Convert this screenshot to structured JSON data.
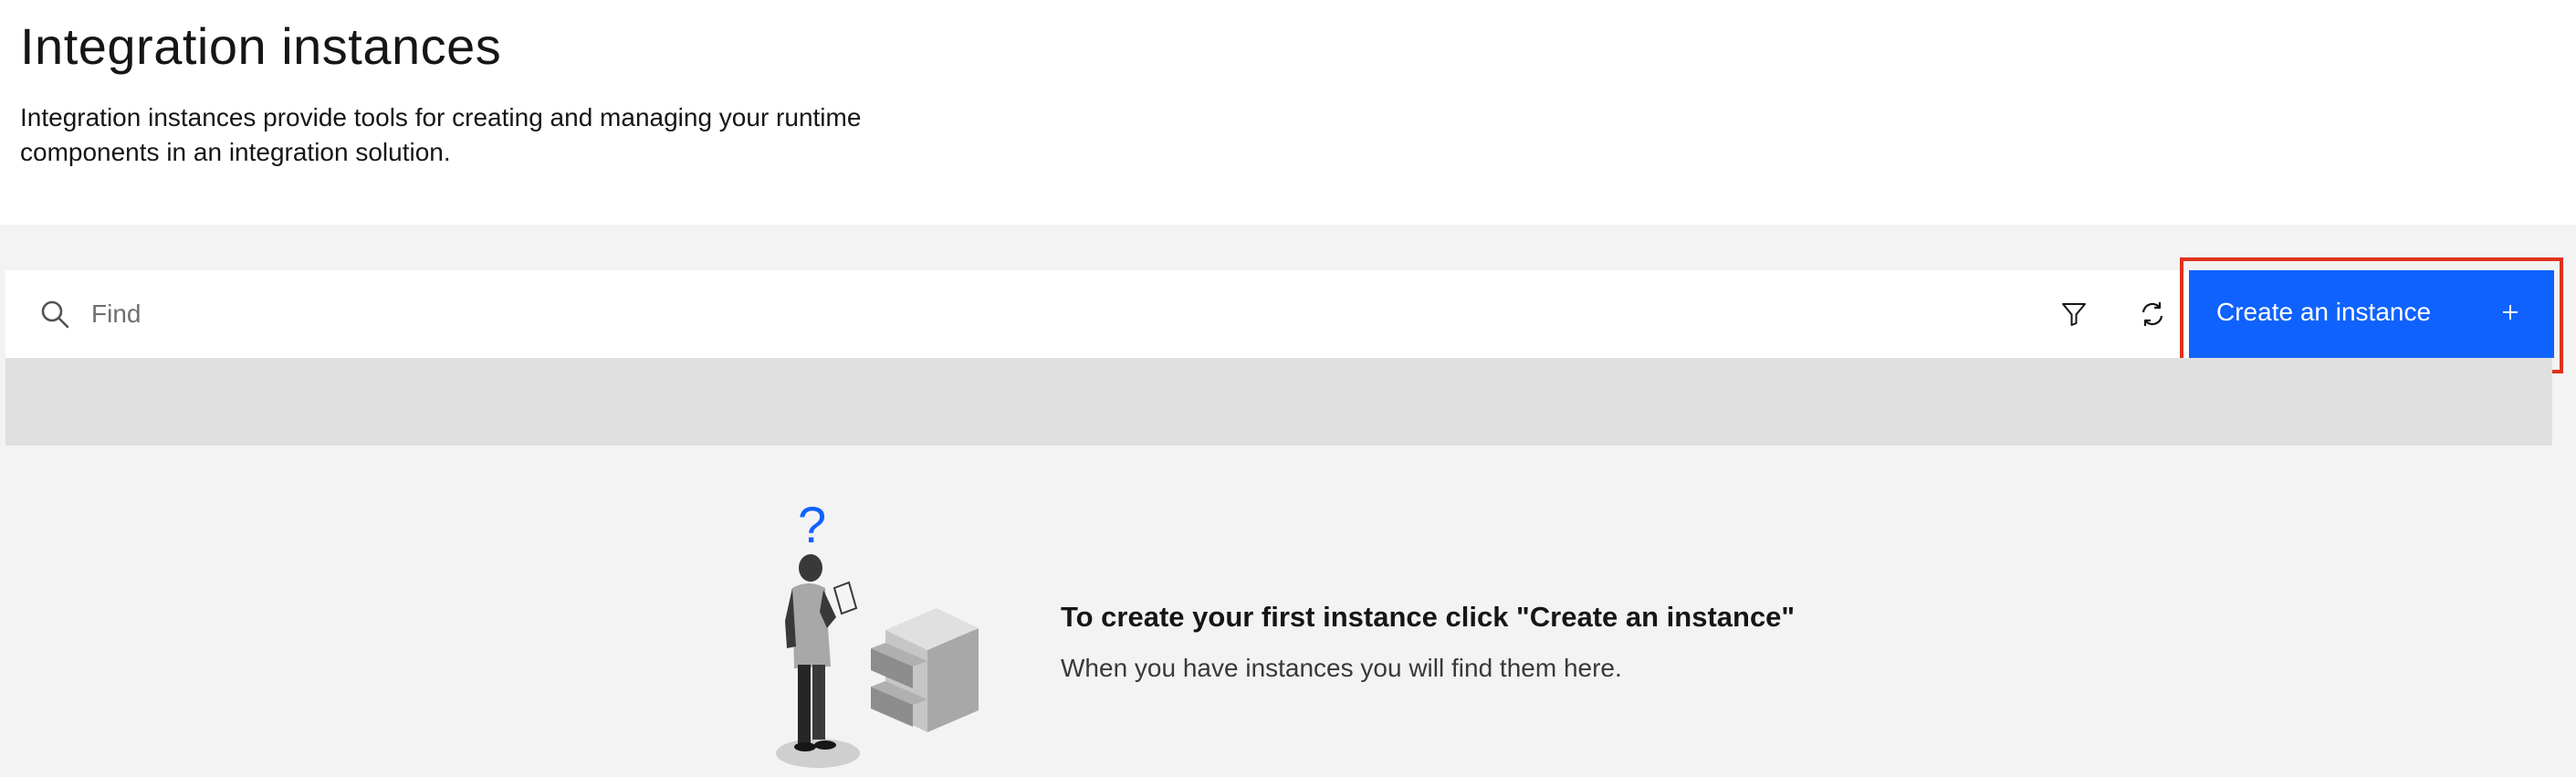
{
  "page": {
    "title": "Integration instances",
    "description": "Integration instances provide tools for creating and managing your runtime components in an integration solution."
  },
  "toolbar": {
    "search_placeholder": "Find",
    "search_value": "",
    "filter_icon": "filter-icon",
    "refresh_icon": "refresh-icon",
    "create_label": "Create an instance",
    "create_icon": "plus-icon"
  },
  "empty_state": {
    "title": "To create your first instance click \"Create an instance\"",
    "subtitle": "When you have instances you will find them here.",
    "question_mark": "?"
  },
  "colors": {
    "primary": "#0f62fe",
    "highlight": "#e0311c",
    "background": "#f3f3f3",
    "header_row": "#e0e0e0"
  }
}
